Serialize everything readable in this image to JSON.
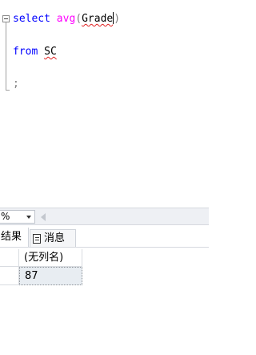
{
  "editor": {
    "lines": {
      "line1": {
        "kw": "select",
        "fn": "avg",
        "open": "(",
        "arg": "Grade",
        "close": ")"
      },
      "line2": {
        "kw": "from",
        "table": "SC"
      },
      "line3": {
        "text": ";"
      }
    }
  },
  "status": {
    "zoom": "%"
  },
  "tabs": {
    "results": "结果",
    "messages": "消息"
  },
  "grid": {
    "column_header": "(无列名)",
    "rows": [
      {
        "value": "87"
      }
    ]
  },
  "colors": {
    "keyword": "#0000ff",
    "function": "#ff00ff",
    "operator": "#808080",
    "selected_cell": "#e8edf2"
  }
}
